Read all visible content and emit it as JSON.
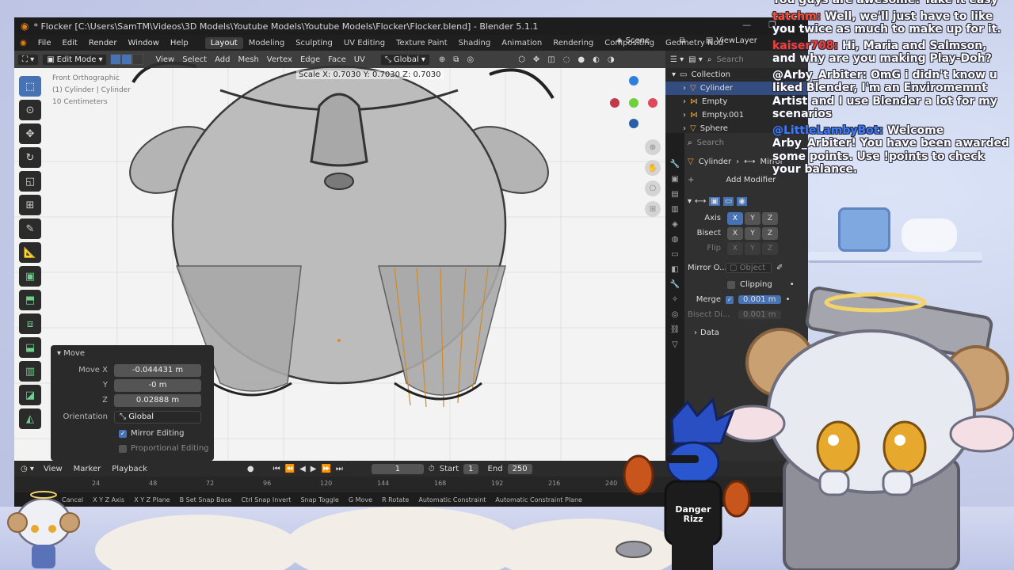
{
  "window": {
    "title": "* Flocker [C:\\Users\\SamTM\\Videos\\3D Models\\Youtube Models\\Youtube Models\\Flocker\\Flocker.blend] - Blender 5.1.1"
  },
  "menu": [
    "File",
    "Edit",
    "Render",
    "Window",
    "Help"
  ],
  "workspaces": [
    {
      "label": "Layout",
      "active": true
    },
    {
      "label": "Modeling"
    },
    {
      "label": "Sculpting"
    },
    {
      "label": "UV Editing"
    },
    {
      "label": "Texture Paint"
    },
    {
      "label": "Shading"
    },
    {
      "label": "Animation"
    },
    {
      "label": "Rendering"
    },
    {
      "label": "Compositing"
    },
    {
      "label": "Geometry Nod"
    }
  ],
  "scene": {
    "label": "Scene",
    "view_layer": "ViewLayer"
  },
  "viewport": {
    "mode": "Edit Mode",
    "menus": [
      "View",
      "Select",
      "Add",
      "Mesh",
      "Vertex",
      "Edge",
      "Face",
      "UV"
    ],
    "orientation": "Global",
    "status_overlay": "Scale X: 0.7030   Y: 0.7030   Z: 0.7030",
    "view_info": [
      "Front Orthographic",
      "(1) Cylinder | Cylinder",
      "10 Centimeters"
    ]
  },
  "redo_panel": {
    "title": "Move",
    "move_x_label": "Move X",
    "move_x": "-0.044431 m",
    "y_label": "Y",
    "y": "-0 m",
    "z_label": "Z",
    "z": "0.02888 m",
    "orientation_label": "Orientation",
    "orientation": "Global",
    "mirror_editing": "Mirror Editing",
    "proportional_editing": "Proportional Editing"
  },
  "outliner": {
    "search_placeholder": "Search",
    "collection": "Collection",
    "items": [
      "Cylinder",
      "Empty",
      "Empty.001",
      "Sphere"
    ]
  },
  "properties": {
    "search_placeholder": "Search",
    "breadcrumb_object": "Cylinder",
    "breadcrumb_modifier": "Mirror",
    "add_modifier": "Add Modifier",
    "axis_label": "Axis",
    "bisect_label": "Bisect",
    "flip_label": "Flip",
    "mirror_object_label": "Mirror O...",
    "mirror_object_placeholder": "Object",
    "clipping_label": "Clipping",
    "merge_label": "Merge",
    "merge_value": "0.001 m",
    "bisect_distance_label": "Bisect Di...",
    "bisect_distance_value": "0.001 m",
    "data_label": "Data",
    "axes": [
      "X",
      "Y",
      "Z"
    ]
  },
  "timeline": {
    "menus": [
      "View",
      "Marker",
      "Playback"
    ],
    "current_frame": "1",
    "start_label": "Start",
    "start": "1",
    "end_label": "End",
    "end": "250",
    "ruler": [
      "24",
      "48",
      "72",
      "96",
      "120",
      "144",
      "168",
      "192",
      "216",
      "240"
    ]
  },
  "statusbar": [
    "Cancel",
    "X Y Z Axis",
    "X Y Z Plane",
    "B Set Snap Base",
    "Ctrl Snap Invert",
    "Snap Toggle",
    "G Move",
    "R Rotate",
    "Automatic Constraint",
    "Automatic Constraint Plane"
  ],
  "chat": [
    {
      "name": "",
      "text": "You guys are awesome! Take it easy",
      "name_color": "#ffffff"
    },
    {
      "name": "tatchm:",
      "text": " Well, we'll just have to like you twice as much to make up for it.",
      "name_color": "#ff4d2e"
    },
    {
      "name": "kaiser708:",
      "text": " Hi, Maria and Salmson, and why are you making Play-Doh?",
      "name_color": "#ff3b2f"
    },
    {
      "name": "@Arby_Arbiter:",
      "text": " OmG i didn't know u liked Blender, I'm an Enviromemnt Artist and I use Blender a lot for my scenarios",
      "name_color": "#ffffff"
    },
    {
      "name": "@LittleLambyBot:",
      "text": " Welcome Arby_Arbiter! You have been awarded some points. Use !points to check your balance.",
      "name_color": "#3a7bff"
    }
  ],
  "overlay": {
    "shirt_line1": "Danger",
    "shirt_line2": "Rizz"
  }
}
